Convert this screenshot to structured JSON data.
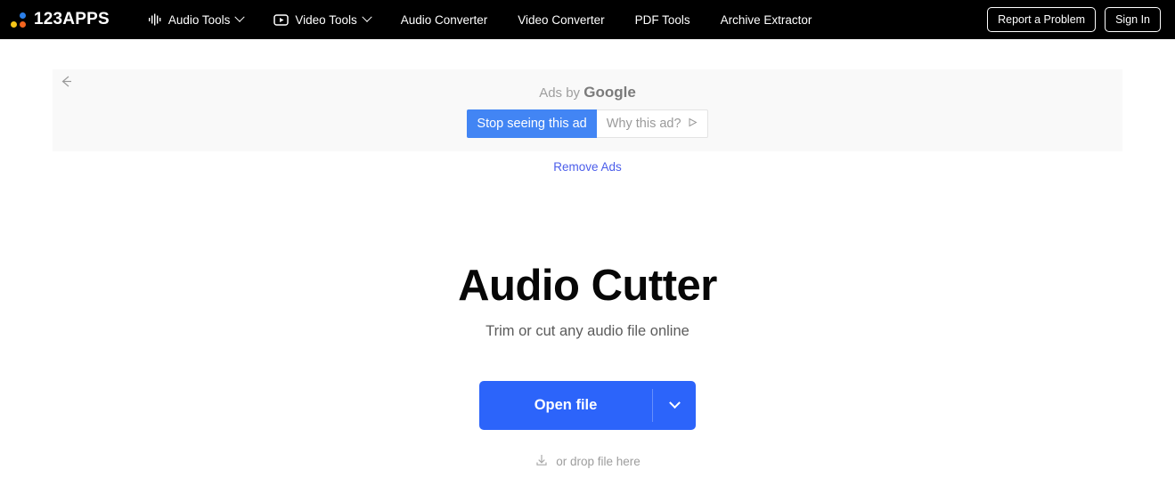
{
  "navbar": {
    "logo": {
      "text": "123APPS",
      "name": "logo",
      "dots": [
        "blue",
        "yellow",
        "orange"
      ]
    },
    "items": [
      {
        "label": "Audio Tools",
        "icon": "waveform-icon",
        "has_caret": true
      },
      {
        "label": "Video Tools",
        "icon": "video-play-icon",
        "has_caret": true
      },
      {
        "label": "Audio Converter",
        "icon": null,
        "has_caret": false
      },
      {
        "label": "Video Converter",
        "icon": null,
        "has_caret": false
      },
      {
        "label": "PDF Tools",
        "icon": null,
        "has_caret": false
      },
      {
        "label": "Archive Extractor",
        "icon": null,
        "has_caret": false
      }
    ],
    "report_problem_label": "Report a Problem",
    "sign_in_label": "Sign In",
    "background_color": "#000000",
    "text_color": "#ffffff"
  },
  "ad": {
    "back_icon": "back-arrow-icon",
    "ads_by_prefix": "Ads by ",
    "ads_by_brand": "Google",
    "stop_seeing_label": "Stop seeing this ad",
    "why_this_ad_label": "Why this ad?",
    "why_this_ad_icon": "triangle-play-icon",
    "stop_button_color": "#4285f4",
    "panel_color": "#f9f9f9",
    "remove_ads_label": "Remove Ads",
    "remove_ads_color": "#4b5dea"
  },
  "hero": {
    "title": "Audio Cutter",
    "subtitle": "Trim or cut any audio file online"
  },
  "action": {
    "open_file_label": "Open file",
    "dropdown_icon": "chevron-down-icon",
    "button_color": "#2c64fa",
    "drop_hint_icon": "download-icon",
    "drop_hint_label": "or drop file here"
  }
}
